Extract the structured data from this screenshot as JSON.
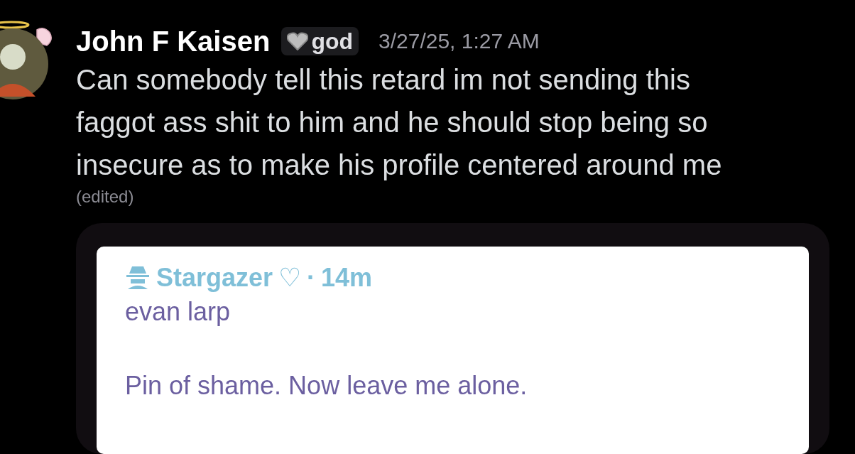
{
  "message": {
    "author": "John F Kaisen",
    "tag": "god",
    "timestamp": "3/27/25, 1:27 AM",
    "text": "Can somebody tell this retard im not sending this faggot ass shit to him and he should stop being so insecure as to make his profile centered around me",
    "edited": "(edited)"
  },
  "embed": {
    "author": "Stargazer",
    "heart": "♡",
    "separator": "·",
    "time": "14m",
    "lines": [
      "evan larp",
      "Pin of shame. Now leave me alone."
    ]
  }
}
